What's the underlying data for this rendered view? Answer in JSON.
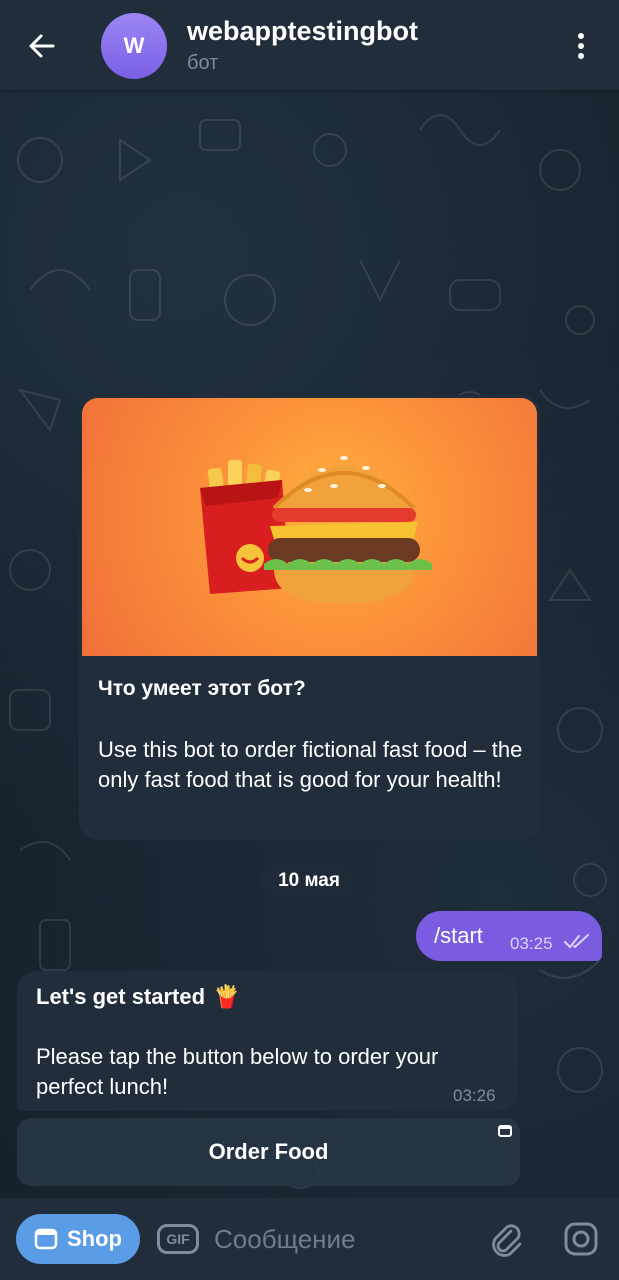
{
  "header": {
    "back_icon": "arrow-left-icon",
    "avatar_letter": "W",
    "title": "webapptestingbot",
    "subtitle": "бот",
    "menu_icon": "more-vertical-icon"
  },
  "intro_card": {
    "image_description_icon": "burger-fries-icon",
    "heading": "Что умеет этот бот?",
    "body": "Use this bot to order fictional fast food – the only fast food that is good for your health!"
  },
  "date_divider": "10 мая",
  "messages": [
    {
      "direction": "outgoing",
      "text": "/start",
      "time": "03:25",
      "status_icon": "double-check-icon"
    },
    {
      "direction": "incoming",
      "heading": "Let's get started",
      "emoji": "🍟",
      "body": "Please tap the button below to order your perfect lunch!",
      "time": "03:26"
    }
  ],
  "inline_button": {
    "label": "Order Food",
    "icon": "webapp-window-icon"
  },
  "input_bar": {
    "shop_label": "Shop",
    "shop_icon": "window-icon",
    "gif_label": "GIF",
    "placeholder": "Сообщение",
    "attach_icon": "paperclip-icon",
    "camera_icon": "instagram-camera-icon"
  },
  "colors": {
    "header_bg": "#212d3b",
    "chat_bg": "#17212b",
    "outgoing_bubble": "#7a5ce0",
    "incoming_bubble": "#212d3b",
    "shop_button": "#5a9de6",
    "avatar": "#8b73ec",
    "image_bg": "#fb8f3a"
  }
}
